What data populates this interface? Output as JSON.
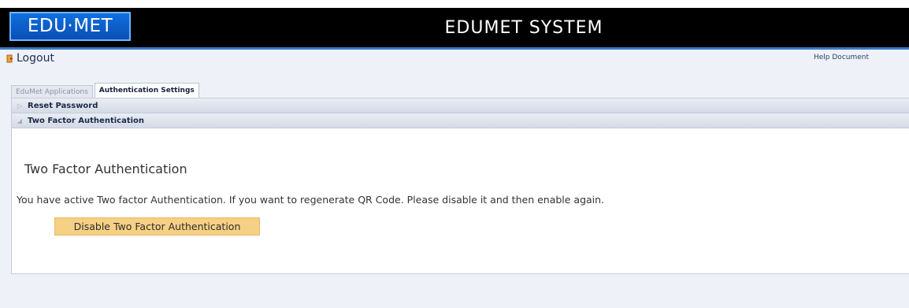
{
  "header": {
    "logo_text": "EDU·MET",
    "app_title": "EDUMET SYSTEM"
  },
  "toolbar": {
    "logout_label": "Logout",
    "logout_icon": "logout-icon",
    "help_label": "Help Document"
  },
  "tabs": [
    {
      "label": "EduMet Applications",
      "active": false
    },
    {
      "label": "Authentication Settings",
      "active": true
    }
  ],
  "accordion": [
    {
      "label": "Reset Password",
      "expanded": false,
      "arrow": "▷"
    },
    {
      "label": "Two Factor Authentication",
      "expanded": true,
      "arrow": "◢"
    }
  ],
  "content": {
    "title": "Two Factor Authentication",
    "message": "You have active Two factor Authentication. If you want to regenerate QR Code. Please disable it and then enable again.",
    "disable_button_label": "Disable Two Factor Authentication"
  },
  "colors": {
    "topbar": "#000000",
    "accent": "#3a79c8",
    "logo_bg": "#0a4fb6",
    "button_bg": "#f6d084",
    "page_bg": "#eef1f7"
  }
}
